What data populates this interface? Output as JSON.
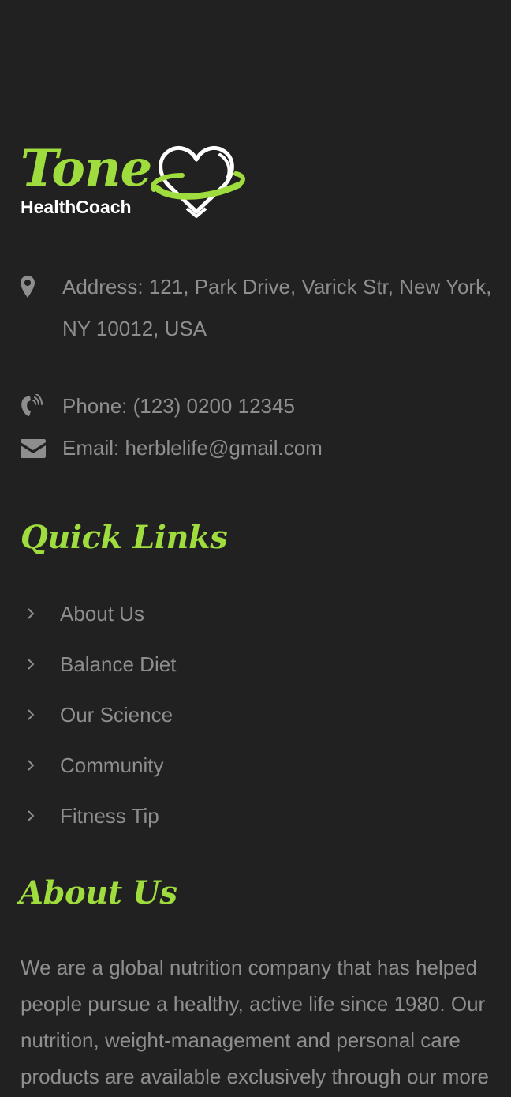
{
  "brand": {
    "name": "Tone",
    "tagline": "HealthCoach",
    "colors": {
      "accent": "#9fdc3d",
      "background": "#212121",
      "text": "#8e8e8e",
      "logo_sub": "#ffffff"
    }
  },
  "contact": {
    "address": {
      "icon": "map-marker-icon",
      "text": "Address: 121, Park Drive, Varick Str, New York, NY 10012, USA"
    },
    "phone": {
      "icon": "phone-volume-icon",
      "text": "Phone: (123) 0200 12345"
    },
    "email": {
      "icon": "envelope-icon",
      "text": "Email: herblelife@gmail.com"
    }
  },
  "quick_links": {
    "heading": "Quick Links",
    "items": [
      {
        "label": "About Us",
        "icon": "chevron-right-icon"
      },
      {
        "label": "Balance Diet",
        "icon": "chevron-right-icon"
      },
      {
        "label": "Our Science",
        "icon": "chevron-right-icon"
      },
      {
        "label": "Community",
        "icon": "chevron-right-icon"
      },
      {
        "label": "Fitness Tip",
        "icon": "chevron-right-icon"
      }
    ]
  },
  "about": {
    "heading": "About Us",
    "text": "We are a global nutrition company that has helped people pursue a healthy, active life since 1980. Our nutrition, weight-management and personal care products are available exclusively through our more"
  }
}
